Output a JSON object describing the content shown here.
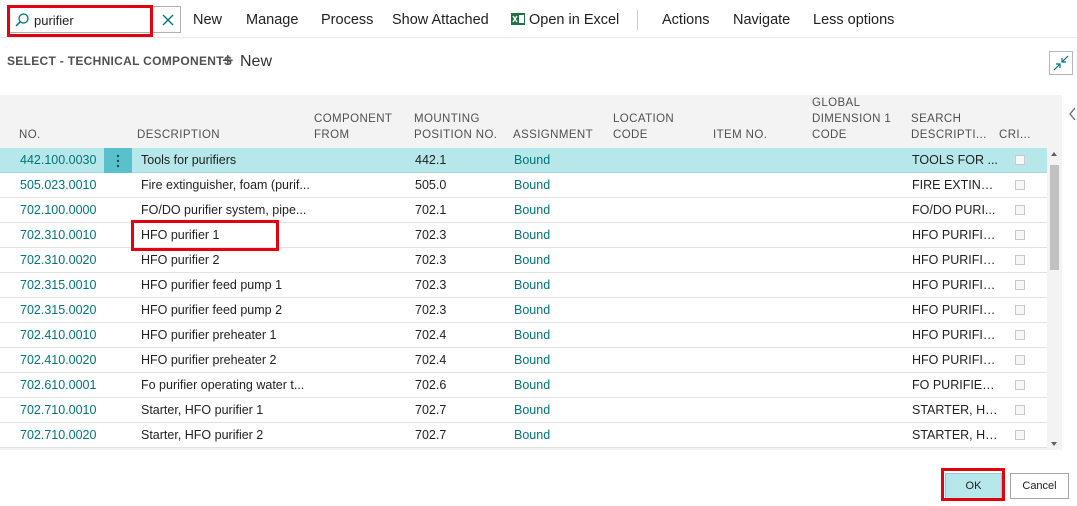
{
  "search": {
    "value": "purifier",
    "placeholder": ""
  },
  "toolbar": {
    "new": "New",
    "manage": "Manage",
    "process": "Process",
    "show_attached": "Show Attached",
    "open_in_excel": "Open in Excel",
    "actions": "Actions",
    "navigate": "Navigate",
    "less_options": "Less options"
  },
  "page": {
    "title": "SELECT - TECHNICAL COMPONENTS",
    "new_label": "New"
  },
  "table": {
    "headers": {
      "no": "NO.",
      "description": "DESCRIPTION",
      "component_from_1": "COMPONENT",
      "component_from_2": "FROM",
      "mounting_1": "MOUNTING",
      "mounting_2": "POSITION NO.",
      "assignment": "ASSIGNMENT",
      "location_1": "LOCATION",
      "location_2": "CODE",
      "item_no": "ITEM NO.",
      "global_1": "GLOBAL",
      "global_2": "DIMENSION 1",
      "global_3": "CODE",
      "search_1": "SEARCH",
      "search_2": "DESCRIPTI...",
      "cri": "CRI..."
    },
    "rows": [
      {
        "no": "442.100.0030",
        "description": "Tools for purifiers",
        "mounting": "442.1",
        "assignment": "Bound",
        "search": "TOOLS FOR ...",
        "selected": true
      },
      {
        "no": "505.023.0010",
        "description": "Fire extinguisher, foam (purif...",
        "mounting": "505.0",
        "assignment": "Bound",
        "search": "FIRE EXTING..."
      },
      {
        "no": "702.100.0000",
        "description": "FO/DO purifier system, pipe...",
        "mounting": "702.1",
        "assignment": "Bound",
        "search": "FO/DO PURI..."
      },
      {
        "no": "702.310.0010",
        "description": "HFO purifier 1",
        "mounting": "702.3",
        "assignment": "Bound",
        "search": "HFO PURIFIE..."
      },
      {
        "no": "702.310.0020",
        "description": "HFO purifier 2",
        "mounting": "702.3",
        "assignment": "Bound",
        "search": "HFO PURIFIE..."
      },
      {
        "no": "702.315.0010",
        "description": "HFO purifier feed pump 1",
        "mounting": "702.3",
        "assignment": "Bound",
        "search": "HFO PURIFIE..."
      },
      {
        "no": "702.315.0020",
        "description": "HFO purifier feed pump 2",
        "mounting": "702.3",
        "assignment": "Bound",
        "search": "HFO PURIFIE..."
      },
      {
        "no": "702.410.0010",
        "description": "HFO purifier preheater 1",
        "mounting": "702.4",
        "assignment": "Bound",
        "search": "HFO PURIFIE..."
      },
      {
        "no": "702.410.0020",
        "description": "HFO purifier preheater 2",
        "mounting": "702.4",
        "assignment": "Bound",
        "search": "HFO PURIFIE..."
      },
      {
        "no": "702.610.0001",
        "description": "Fo purifier operating water t...",
        "mounting": "702.6",
        "assignment": "Bound",
        "search": "FO PURIFIER ..."
      },
      {
        "no": "702.710.0010",
        "description": "Starter, HFO purifier 1",
        "mounting": "702.7",
        "assignment": "Bound",
        "search": "STARTER, HF..."
      },
      {
        "no": "702.710.0020",
        "description": "Starter, HFO purifier 2",
        "mounting": "702.7",
        "assignment": "Bound",
        "search": "STARTER, HF..."
      }
    ]
  },
  "footer": {
    "ok": "OK",
    "cancel": "Cancel"
  },
  "colors": {
    "accent": "#00747a",
    "selected_row": "#b6e7eb",
    "highlight": "#e3000f",
    "row_menu": "#58c1cc"
  }
}
